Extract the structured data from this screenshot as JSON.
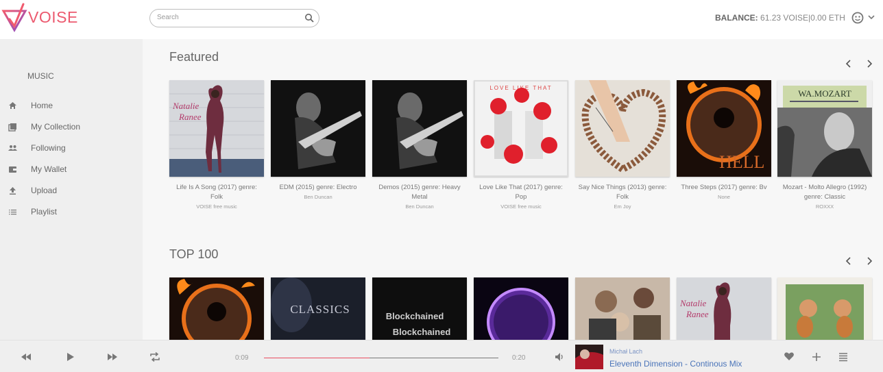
{
  "header": {
    "logo_text": "VOISE",
    "search_placeholder": "Search",
    "balance_label": "BALANCE:",
    "balance_value": "61.23 VOISE|0.00 ETH"
  },
  "sidebar": {
    "heading": "MUSIC",
    "items": [
      {
        "label": "Home",
        "icon": "home-icon"
      },
      {
        "label": "My Collection",
        "icon": "collection-icon"
      },
      {
        "label": "Following",
        "icon": "people-icon"
      },
      {
        "label": "My Wallet",
        "icon": "wallet-icon"
      },
      {
        "label": "Upload",
        "icon": "upload-icon"
      },
      {
        "label": "Playlist",
        "icon": "list-icon"
      }
    ]
  },
  "featured": {
    "title": "Featured",
    "albums": [
      {
        "title": "Life Is A Song (2017) genre: Folk",
        "artist": "VOISE free music"
      },
      {
        "title": "EDM (2015) genre: Electro",
        "artist": "Ben Duncan"
      },
      {
        "title": "Demos (2015) genre: Heavy Metal",
        "artist": "Ben Duncan"
      },
      {
        "title": "Love Like That (2017) genre: Pop",
        "artist": "VOISE free music"
      },
      {
        "title": "Say Nice Things (2013) genre: Folk",
        "artist": "Em Joy"
      },
      {
        "title": "Three Steps (2017) genre: Bv",
        "artist": "None"
      },
      {
        "title": "Mozart - Molto Allegro (1992) genre: Classic",
        "artist": "ROXXX"
      }
    ]
  },
  "top100": {
    "title": "TOP 100",
    "cover_texts": {
      "classics": "CLASSICS",
      "blockchained_1": "Blockchained",
      "blockchained_2": "Blockchained"
    }
  },
  "cover_texts": {
    "natalie": "Natalie",
    "ranee": "Ranee",
    "love_like_that": "LOVE LIKE THAT",
    "hell": "HELL",
    "mozart": "WA.MOZART"
  },
  "player": {
    "current_time": "0:09",
    "total_time": "0:20",
    "progress": 0.45,
    "artist": "Michał Lach",
    "track": "Eleventh Dimension - Continous Mix"
  },
  "colors": {
    "brand": "#ec5a6f",
    "link": "#4a74b9",
    "progress": "#e84c5f"
  }
}
